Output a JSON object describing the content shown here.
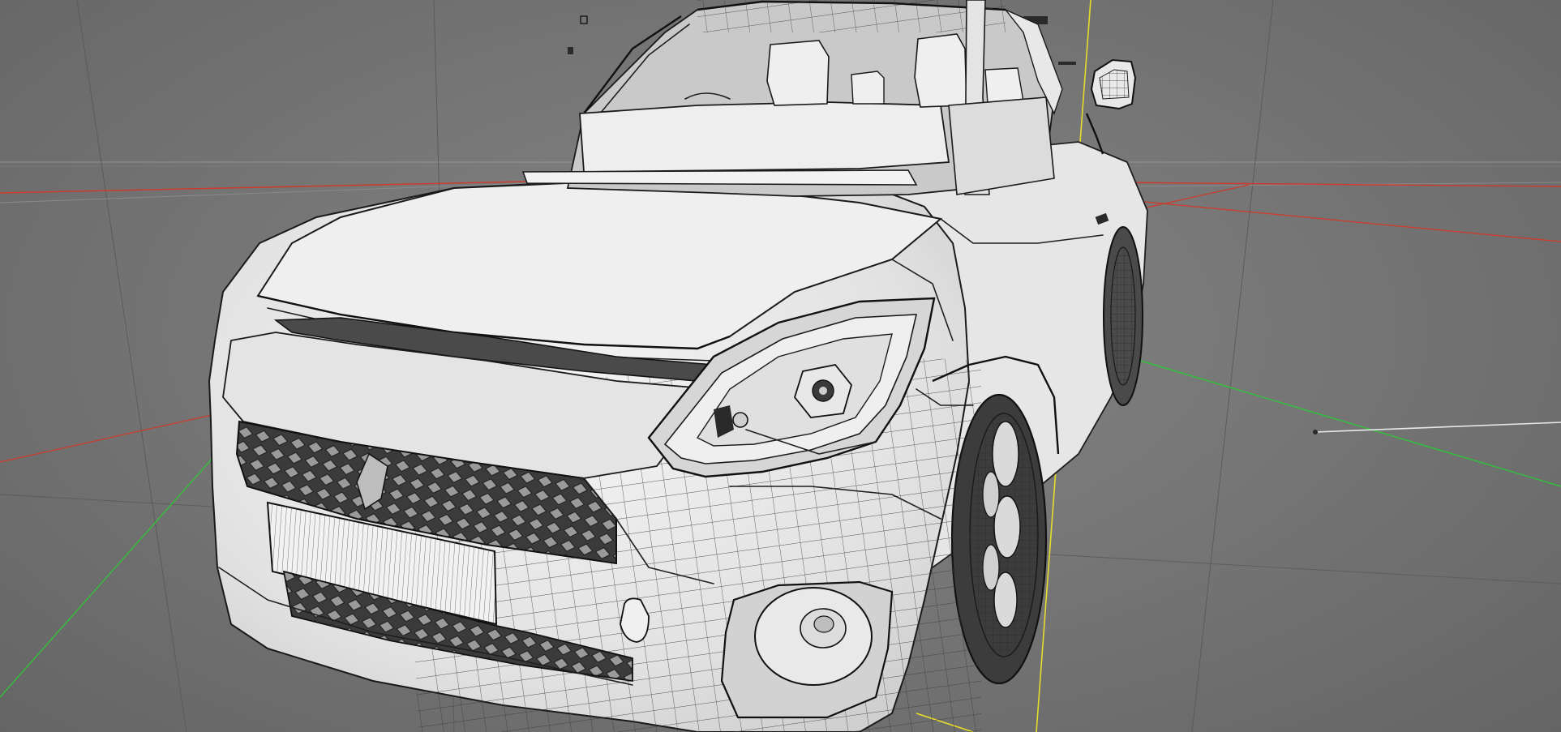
{
  "viewport": {
    "background_color": "#777777",
    "axis_colors": {
      "x_axis": "#d03a2a",
      "y_axis": "#e6dc2a",
      "z_axis": "#2ec43a"
    },
    "model": {
      "name": "car-wireframe-model",
      "surface_color": "#ececec",
      "wire_color": "#1f1f1f"
    }
  }
}
